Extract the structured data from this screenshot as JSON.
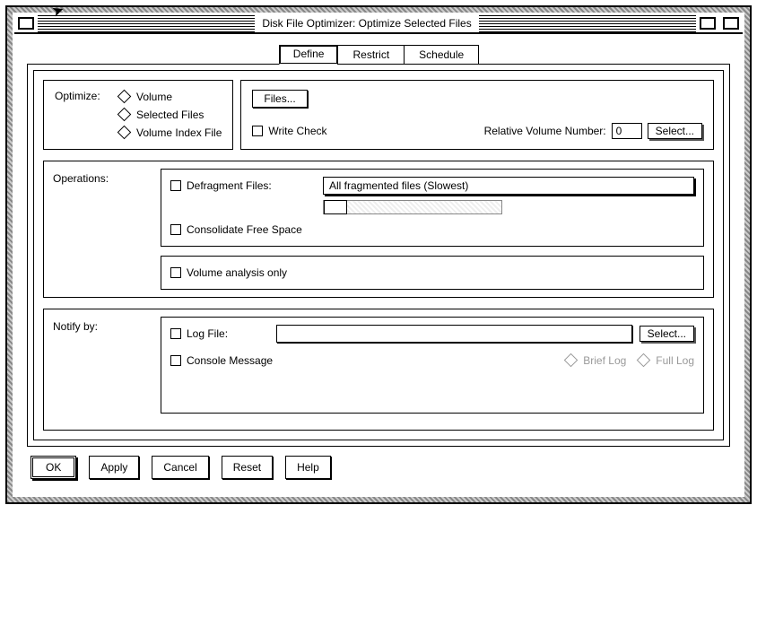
{
  "window": {
    "title": "Disk File Optimizer: Optimize Selected Files"
  },
  "tabs": {
    "define": "Define",
    "restrict": "Restrict",
    "schedule": "Schedule"
  },
  "optimize": {
    "label": "Optimize:",
    "volume": "Volume",
    "selected": "Selected Files",
    "indexfile": "Volume Index File",
    "files_btn": "Files...",
    "write_check": "Write Check",
    "rel_vol_label": "Relative Volume Number:",
    "rel_vol_value": "0",
    "select_btn": "Select..."
  },
  "operations": {
    "label": "Operations:",
    "defrag": "Defragment Files:",
    "defrag_option": "All fragmented files (Slowest)",
    "consolidate": "Consolidate Free Space",
    "analysis": "Volume analysis only"
  },
  "notify": {
    "label": "Notify by:",
    "logfile": "Log File:",
    "logfile_value": "",
    "select_btn": "Select...",
    "console": "Console Message",
    "brief": "Brief Log",
    "full": "Full Log"
  },
  "buttons": {
    "ok": "OK",
    "apply": "Apply",
    "cancel": "Cancel",
    "reset": "Reset",
    "help": "Help"
  }
}
